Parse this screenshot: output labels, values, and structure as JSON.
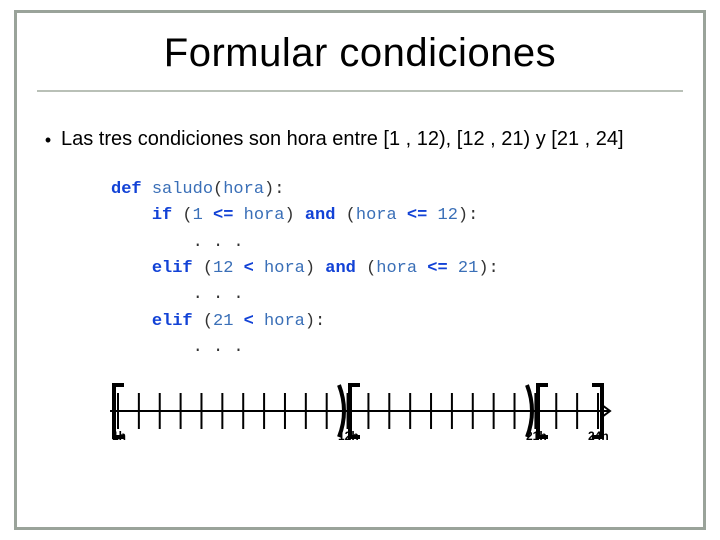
{
  "title": "Formular condiciones",
  "bullet": "Las tres condiciones son hora entre [1 , 12), [12 , 21) y [21 , 24]",
  "code": {
    "def": "def",
    "fn": "saludo",
    "param": "hora",
    "if": "if",
    "elif": "elif",
    "and": "and",
    "lte": "<=",
    "lt": "<",
    "n1": "1",
    "n12": "12",
    "n21": "21",
    "dots": ". . ."
  },
  "diagram": {
    "labels": {
      "l1": "1h",
      "l12": "12h",
      "l21": "21h",
      "l24": "24h"
    }
  }
}
